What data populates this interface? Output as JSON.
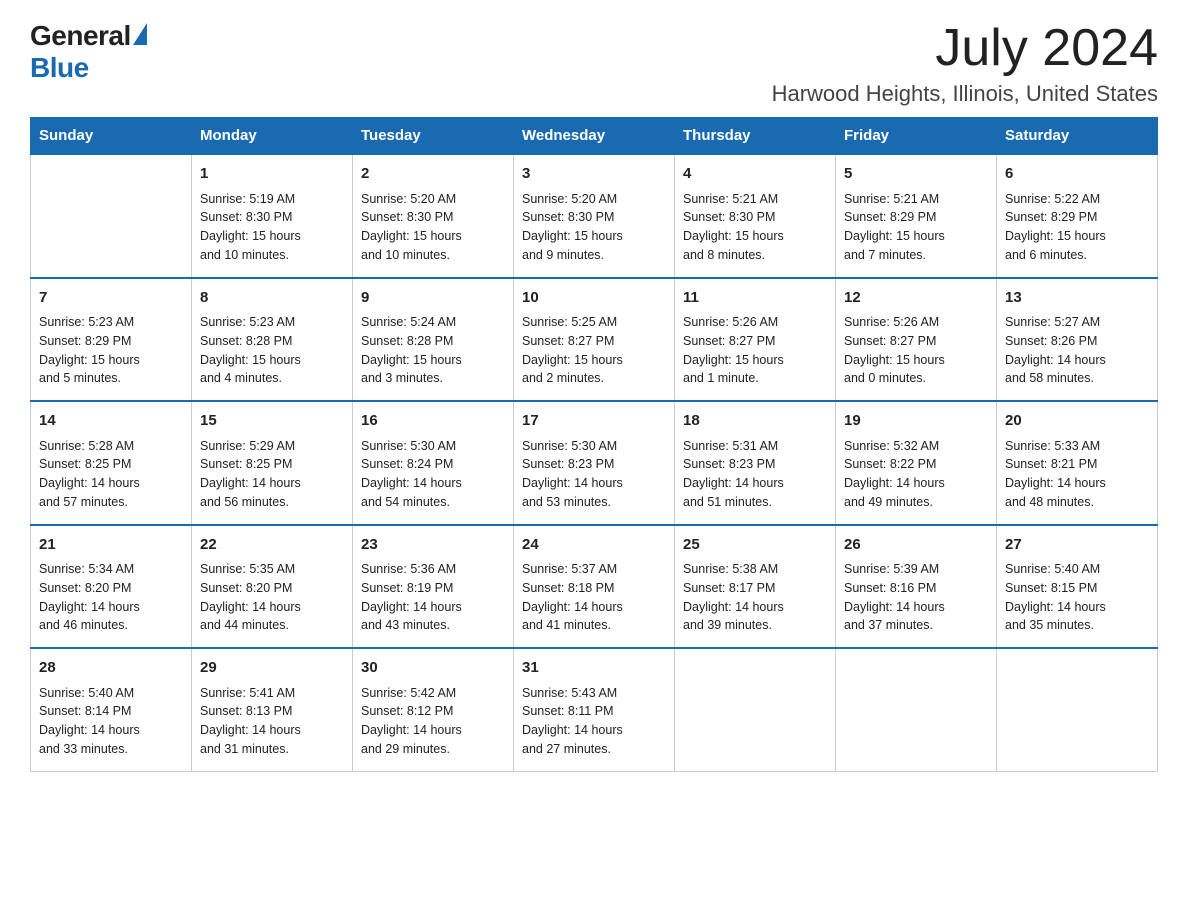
{
  "header": {
    "logo_general": "General",
    "logo_blue": "Blue",
    "month_title": "July 2024",
    "location": "Harwood Heights, Illinois, United States"
  },
  "days_of_week": [
    "Sunday",
    "Monday",
    "Tuesday",
    "Wednesday",
    "Thursday",
    "Friday",
    "Saturday"
  ],
  "weeks": [
    [
      {
        "day": "",
        "info": ""
      },
      {
        "day": "1",
        "info": "Sunrise: 5:19 AM\nSunset: 8:30 PM\nDaylight: 15 hours\nand 10 minutes."
      },
      {
        "day": "2",
        "info": "Sunrise: 5:20 AM\nSunset: 8:30 PM\nDaylight: 15 hours\nand 10 minutes."
      },
      {
        "day": "3",
        "info": "Sunrise: 5:20 AM\nSunset: 8:30 PM\nDaylight: 15 hours\nand 9 minutes."
      },
      {
        "day": "4",
        "info": "Sunrise: 5:21 AM\nSunset: 8:30 PM\nDaylight: 15 hours\nand 8 minutes."
      },
      {
        "day": "5",
        "info": "Sunrise: 5:21 AM\nSunset: 8:29 PM\nDaylight: 15 hours\nand 7 minutes."
      },
      {
        "day": "6",
        "info": "Sunrise: 5:22 AM\nSunset: 8:29 PM\nDaylight: 15 hours\nand 6 minutes."
      }
    ],
    [
      {
        "day": "7",
        "info": "Sunrise: 5:23 AM\nSunset: 8:29 PM\nDaylight: 15 hours\nand 5 minutes."
      },
      {
        "day": "8",
        "info": "Sunrise: 5:23 AM\nSunset: 8:28 PM\nDaylight: 15 hours\nand 4 minutes."
      },
      {
        "day": "9",
        "info": "Sunrise: 5:24 AM\nSunset: 8:28 PM\nDaylight: 15 hours\nand 3 minutes."
      },
      {
        "day": "10",
        "info": "Sunrise: 5:25 AM\nSunset: 8:27 PM\nDaylight: 15 hours\nand 2 minutes."
      },
      {
        "day": "11",
        "info": "Sunrise: 5:26 AM\nSunset: 8:27 PM\nDaylight: 15 hours\nand 1 minute."
      },
      {
        "day": "12",
        "info": "Sunrise: 5:26 AM\nSunset: 8:27 PM\nDaylight: 15 hours\nand 0 minutes."
      },
      {
        "day": "13",
        "info": "Sunrise: 5:27 AM\nSunset: 8:26 PM\nDaylight: 14 hours\nand 58 minutes."
      }
    ],
    [
      {
        "day": "14",
        "info": "Sunrise: 5:28 AM\nSunset: 8:25 PM\nDaylight: 14 hours\nand 57 minutes."
      },
      {
        "day": "15",
        "info": "Sunrise: 5:29 AM\nSunset: 8:25 PM\nDaylight: 14 hours\nand 56 minutes."
      },
      {
        "day": "16",
        "info": "Sunrise: 5:30 AM\nSunset: 8:24 PM\nDaylight: 14 hours\nand 54 minutes."
      },
      {
        "day": "17",
        "info": "Sunrise: 5:30 AM\nSunset: 8:23 PM\nDaylight: 14 hours\nand 53 minutes."
      },
      {
        "day": "18",
        "info": "Sunrise: 5:31 AM\nSunset: 8:23 PM\nDaylight: 14 hours\nand 51 minutes."
      },
      {
        "day": "19",
        "info": "Sunrise: 5:32 AM\nSunset: 8:22 PM\nDaylight: 14 hours\nand 49 minutes."
      },
      {
        "day": "20",
        "info": "Sunrise: 5:33 AM\nSunset: 8:21 PM\nDaylight: 14 hours\nand 48 minutes."
      }
    ],
    [
      {
        "day": "21",
        "info": "Sunrise: 5:34 AM\nSunset: 8:20 PM\nDaylight: 14 hours\nand 46 minutes."
      },
      {
        "day": "22",
        "info": "Sunrise: 5:35 AM\nSunset: 8:20 PM\nDaylight: 14 hours\nand 44 minutes."
      },
      {
        "day": "23",
        "info": "Sunrise: 5:36 AM\nSunset: 8:19 PM\nDaylight: 14 hours\nand 43 minutes."
      },
      {
        "day": "24",
        "info": "Sunrise: 5:37 AM\nSunset: 8:18 PM\nDaylight: 14 hours\nand 41 minutes."
      },
      {
        "day": "25",
        "info": "Sunrise: 5:38 AM\nSunset: 8:17 PM\nDaylight: 14 hours\nand 39 minutes."
      },
      {
        "day": "26",
        "info": "Sunrise: 5:39 AM\nSunset: 8:16 PM\nDaylight: 14 hours\nand 37 minutes."
      },
      {
        "day": "27",
        "info": "Sunrise: 5:40 AM\nSunset: 8:15 PM\nDaylight: 14 hours\nand 35 minutes."
      }
    ],
    [
      {
        "day": "28",
        "info": "Sunrise: 5:40 AM\nSunset: 8:14 PM\nDaylight: 14 hours\nand 33 minutes."
      },
      {
        "day": "29",
        "info": "Sunrise: 5:41 AM\nSunset: 8:13 PM\nDaylight: 14 hours\nand 31 minutes."
      },
      {
        "day": "30",
        "info": "Sunrise: 5:42 AM\nSunset: 8:12 PM\nDaylight: 14 hours\nand 29 minutes."
      },
      {
        "day": "31",
        "info": "Sunrise: 5:43 AM\nSunset: 8:11 PM\nDaylight: 14 hours\nand 27 minutes."
      },
      {
        "day": "",
        "info": ""
      },
      {
        "day": "",
        "info": ""
      },
      {
        "day": "",
        "info": ""
      }
    ]
  ]
}
